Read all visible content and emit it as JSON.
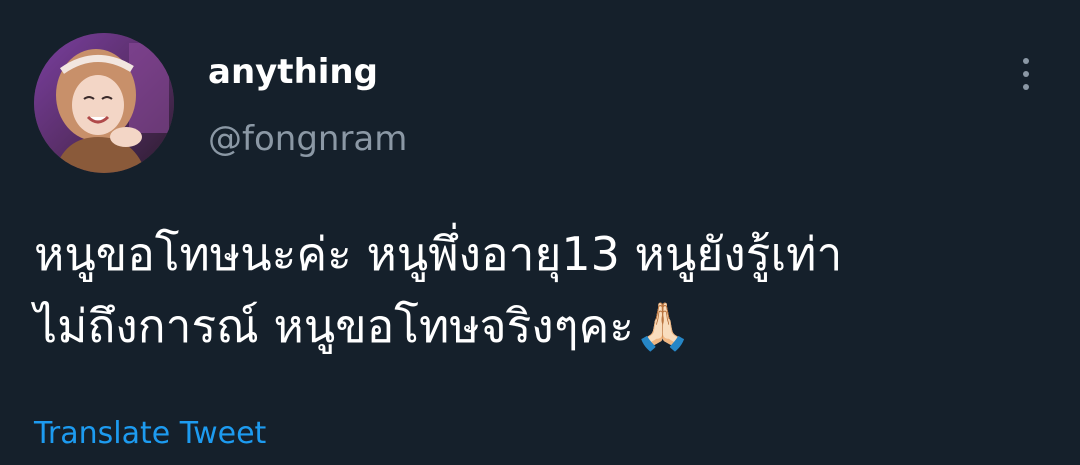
{
  "tweet": {
    "display_name": "anything",
    "handle": "@fongnram",
    "text": "หนูขอโทษนะค่ะ หนูพึ่งอายุ13 หนูยังรู้เท่า\nไม่ถึงการณ์ หนูขอโทษจริงๆคะ🙏🏻",
    "translate_label": "Translate Tweet",
    "avatar_icon": "profile-photo",
    "more_icon": "more-vertical-icon"
  },
  "colors": {
    "background": "#15202b",
    "primary_text": "#ffffff",
    "secondary_text": "#8b98a5",
    "link": "#1d9bf0"
  }
}
